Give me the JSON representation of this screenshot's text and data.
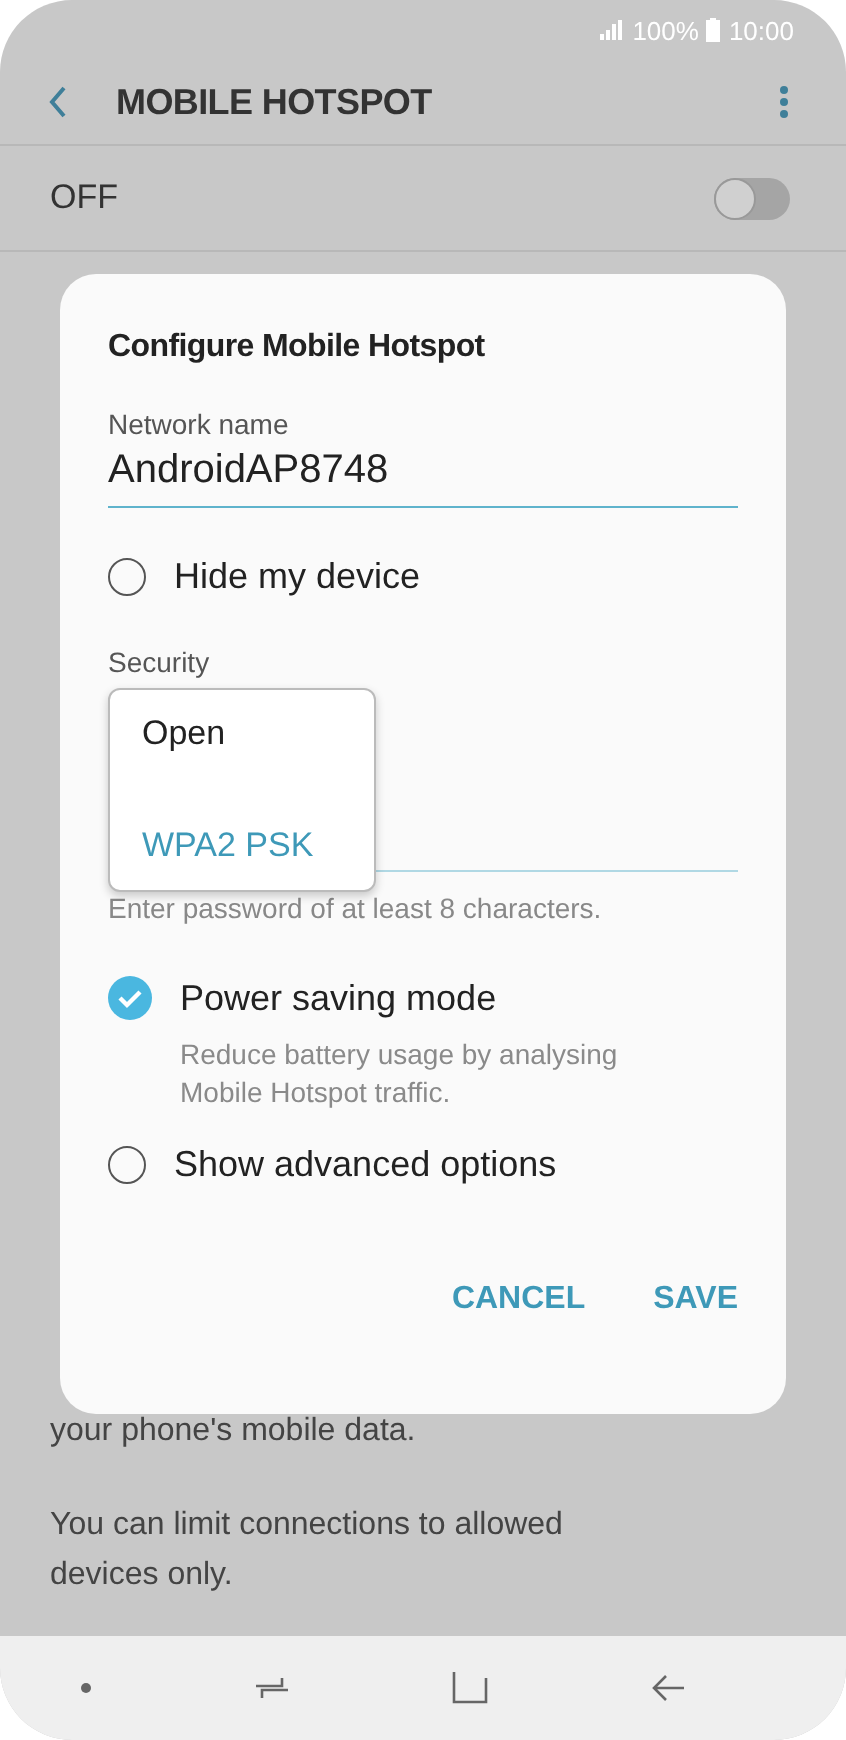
{
  "status_bar": {
    "battery": "100%",
    "time": "10:00"
  },
  "app_bar": {
    "title": "MOBILE HOTSPOT"
  },
  "master_switch": {
    "label": "OFF",
    "on": false
  },
  "background_text": [
    "your phone's mobile data.",
    "You can limit connections to allowed devices only."
  ],
  "dialog": {
    "title": "Configure Mobile Hotspot",
    "network_name": {
      "label": "Network name",
      "value": "AndroidAP8748"
    },
    "hide_device": {
      "label": "Hide my device",
      "checked": false
    },
    "security": {
      "label": "Security",
      "options": [
        {
          "label": "Open",
          "selected": false
        },
        {
          "label": "WPA2 PSK",
          "selected": true
        }
      ]
    },
    "password": {
      "hint": "Enter password of at least 8 characters."
    },
    "power_saving": {
      "label": "Power saving mode",
      "description": "Reduce battery usage by analysing Mobile Hotspot traffic.",
      "checked": true
    },
    "advanced": {
      "label": "Show advanced options",
      "checked": false
    },
    "buttons": [
      "CANCEL",
      "SAVE"
    ]
  }
}
